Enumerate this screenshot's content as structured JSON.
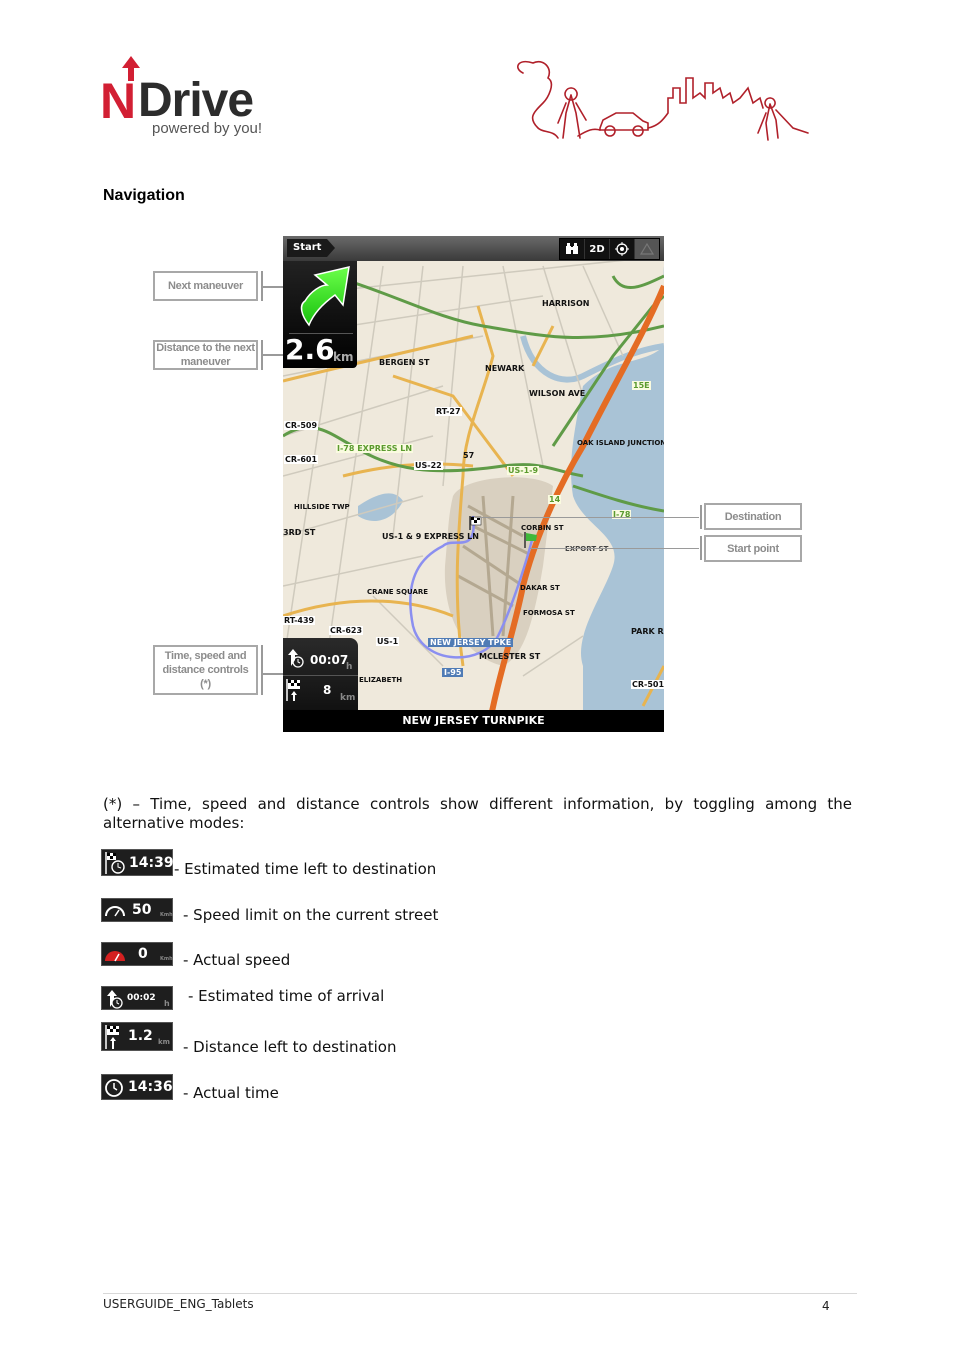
{
  "header": {
    "logo": {
      "brand_first": "N",
      "brand_rest": "Drive",
      "tagline": "powered by you!"
    },
    "banner": "journey-illustration"
  },
  "section_title": "Navigation",
  "callouts": {
    "next_maneuver": "Next maneuver",
    "distance_next_maneuver": "Distance to the next maneuver",
    "time_speed_distance": "Time, speed and distance controls (*)",
    "destination": "Destination",
    "start_point": "Start point"
  },
  "map": {
    "topbar": {
      "start_label": "Start",
      "buttons": [
        "binoculars-icon",
        "2D",
        "locate-icon",
        "warning-icon"
      ],
      "mode_label": "2D"
    },
    "maneuver": {
      "icon": "turn-right-arrow-icon",
      "distance": "2.6",
      "unit": "km"
    },
    "info_panel": {
      "eta": {
        "value": "00:07",
        "unit": "h"
      },
      "distance": {
        "value": "8",
        "unit": "km"
      }
    },
    "current_street": "NEW JERSEY TURNPIKE",
    "labels": {
      "harrison": "HARRISON",
      "bergen_st": "BERGEN ST",
      "newark": "NEWARK",
      "wilson_ave": "WILSON AVE",
      "l15e": "15E",
      "rt27": "RT-27",
      "cr509": "CR-509",
      "oak_island": "OAK ISLAND JUNCTION",
      "i78_express": "I-78 EXPRESS LN",
      "l57": "57",
      "cr601": "CR-601",
      "us22": "US-22",
      "us19": "US-1-9",
      "l14": "14",
      "hillside": "HILLSIDE TWP",
      "i78": "I-78",
      "third_st": "3RD ST",
      "corbin_st": "CORBIN ST",
      "us19_express": "US-1 & 9 EXPRESS LN",
      "export_st": "EXPORT ST",
      "dakar_st": "DAKAR ST",
      "crane_square": "CRANE SQUARE",
      "formosa_st": "FORMOSA ST",
      "rt439": "RT-439",
      "cr623": "CR-623",
      "park_r": "PARK R",
      "us1": "US-1",
      "nj_tpke": "NEW JERSEY TPKE",
      "mclester_st": "MCLESTER ST",
      "elizabeth": "ELIZABETH",
      "i95": "I-95",
      "cr501": "CR-501"
    }
  },
  "intro": {
    "line1": "(*) – Time, speed and distance controls show different information, by toggling among the",
    "line2": "alternative modes:"
  },
  "modes": [
    {
      "icon": "flag-clock-icon",
      "value": "14:39",
      "unit": "",
      "text": "- Estimated time left to destination"
    },
    {
      "icon": "speedometer-icon",
      "value": "50",
      "unit": "Kmh",
      "text": "- Speed limit on the current street"
    },
    {
      "icon": "speedometer-red-icon",
      "value": "0",
      "unit": "Kmh",
      "text": "- Actual speed"
    },
    {
      "icon": "arrow-clock-icon",
      "value": "00:02",
      "unit": "h",
      "text": "- Estimated time of arrival"
    },
    {
      "icon": "flag-distance-icon",
      "value": "1.2",
      "unit": "km",
      "text": "- Distance left to destination"
    },
    {
      "icon": "clock-icon",
      "value": "14:36",
      "unit": "",
      "text": "- Actual time"
    }
  ],
  "footer": {
    "doc_name": "USERGUIDE_ENG_Tablets",
    "page_number": "4"
  }
}
